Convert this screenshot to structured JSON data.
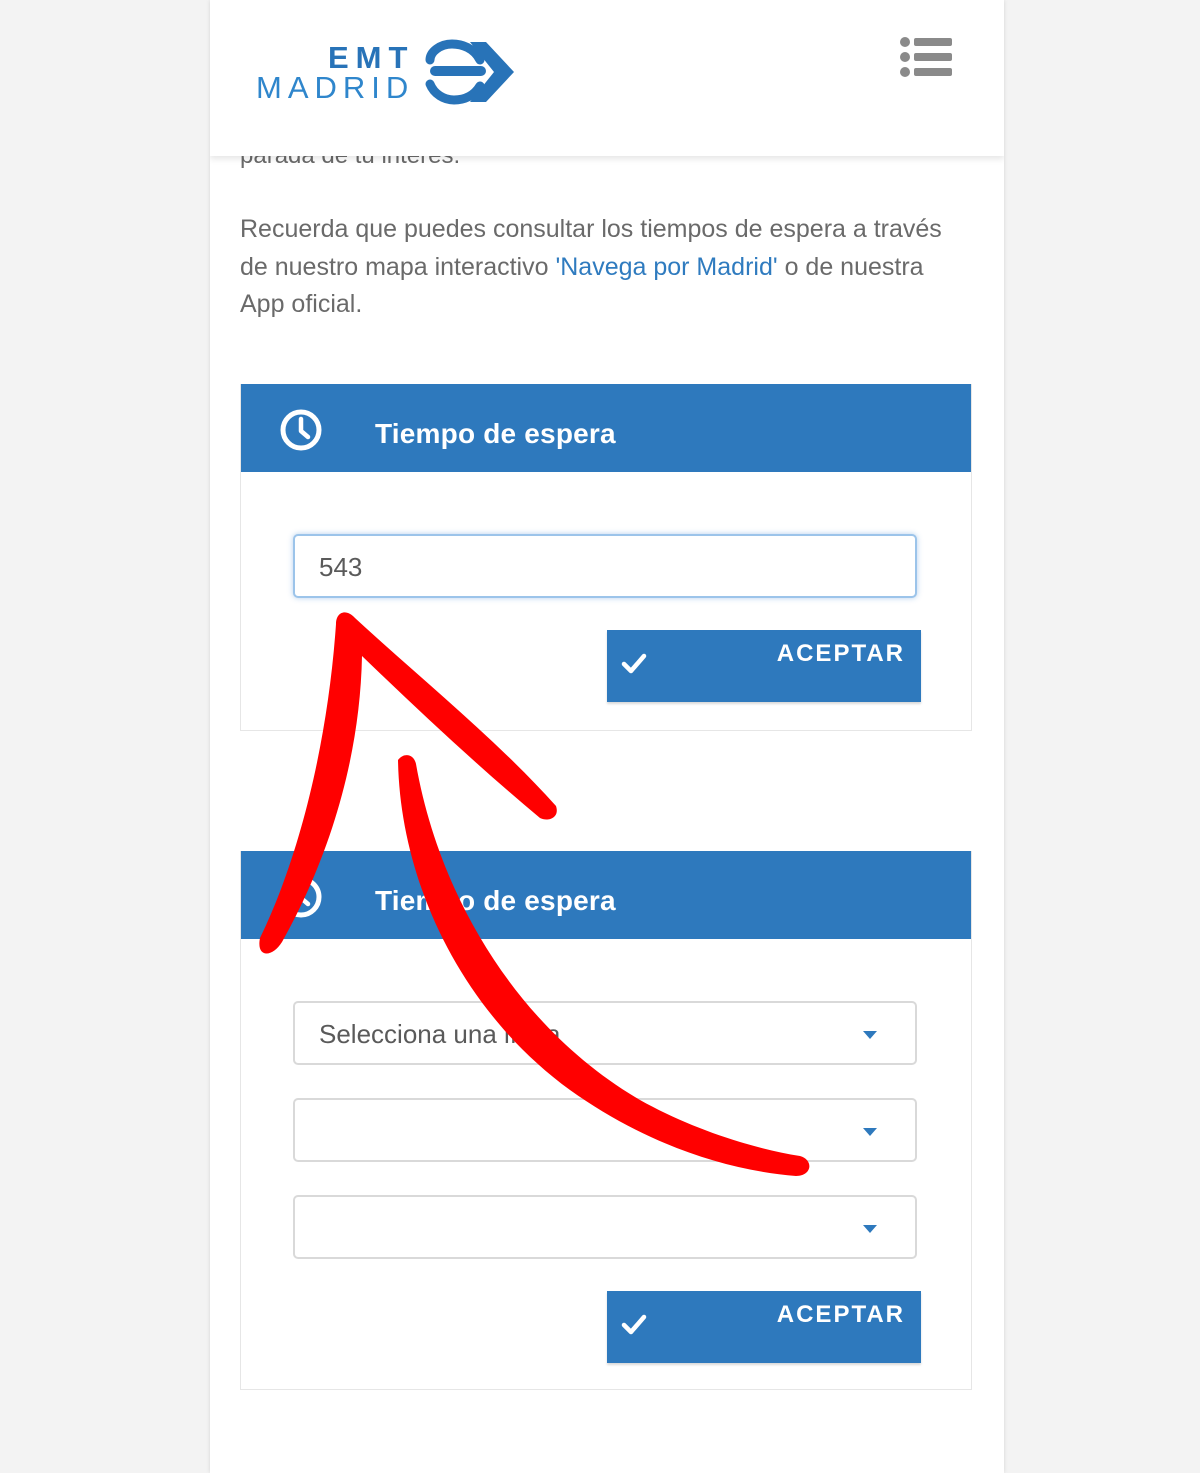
{
  "header": {
    "logo_top": "EMT",
    "logo_bottom": "MADRID",
    "menu_icon": "list-menu-icon"
  },
  "intro": {
    "cut_text": "parada de tu interés.",
    "text_before": "Recuerda que puedes consultar los tiempos de espera a través de nuestro mapa interactivo ",
    "link_text": "'Navega por Madrid'",
    "text_after": " o de nuestra App oficial."
  },
  "panel_stop": {
    "title": "Tiempo de espera",
    "icon": "clock-icon",
    "input_value": "543",
    "button_label": "ACEPTAR",
    "button_icon": "check-icon"
  },
  "panel_line": {
    "title": "Tiempo de espera",
    "icon": "clock-icon",
    "select_1_value": "Selecciona una línea",
    "select_2_value": "",
    "select_3_value": "",
    "button_label": "ACEPTAR",
    "button_icon": "check-icon"
  },
  "colors": {
    "brand_blue": "#2e79bd",
    "link_blue": "#2f7bbf",
    "annotation_red": "#ff0000"
  }
}
